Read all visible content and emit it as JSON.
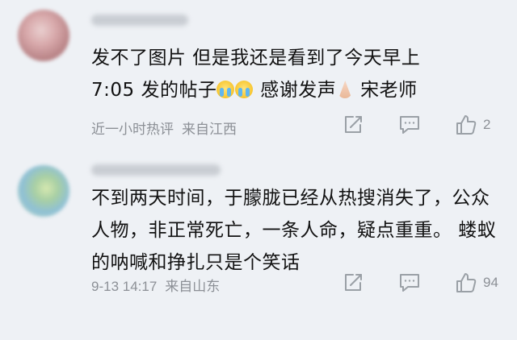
{
  "comments": [
    {
      "text_line1": "发不了图片 但是我还是看到了今天早上",
      "text_line2_a": "7:05 发的帖子",
      "text_line2_b": " 感谢发声",
      "text_line2_c": " 宋老师",
      "time": "近一小时热评",
      "location": "来自江西",
      "likes": "2",
      "icons": [
        "share-icon",
        "reply-icon",
        "thumbs-up-icon"
      ]
    },
    {
      "text": "不到两天时间，于朦胧已经从热搜消失了，公众人物，非正常死亡，一条人命，疑点重重。 蝼蚁的呐喊和挣扎只是个笑话",
      "time": "9-13 14:17",
      "location": "来自山东",
      "likes": "94",
      "icons": [
        "share-icon",
        "reply-icon",
        "thumbs-up-icon"
      ]
    }
  ],
  "colors": {
    "background": "#eef1f5",
    "text": "#111111",
    "meta": "#8c9096",
    "icon": "#9aa0a6"
  }
}
